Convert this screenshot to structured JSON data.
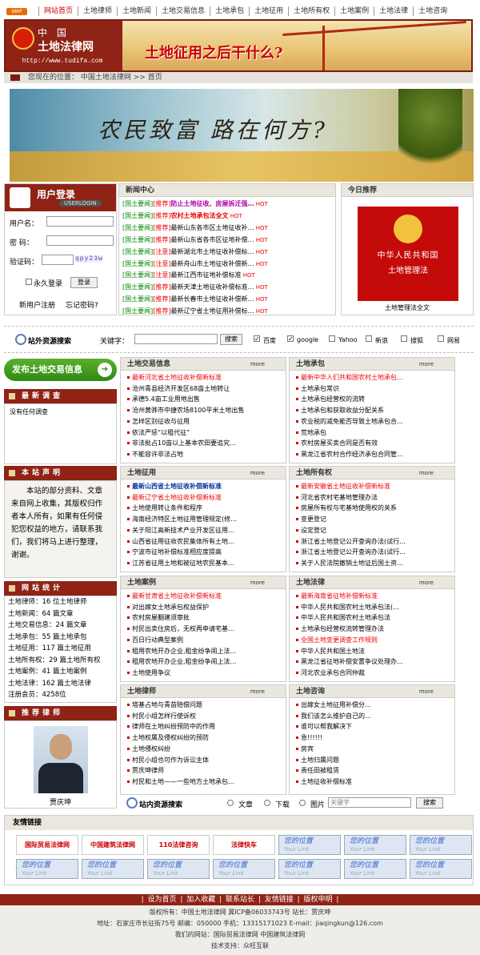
{
  "nav": {
    "wap": "WAP",
    "items": [
      "网站首页",
      "土地律师",
      "土地新闻",
      "土地交易信息",
      "土地承包",
      "土地征用",
      "土地所有权",
      "土地案例",
      "土地法律",
      "土地咨询"
    ]
  },
  "header": {
    "site_cn_1": "中  国",
    "site_cn_2": "土地法律网",
    "url": "http://www.tudifa.com",
    "slogan": "土地征用之后干什么?"
  },
  "location": {
    "label": "您现在的位置：",
    "path": "中国土地法律网 >> 首页"
  },
  "farm_banner": {
    "text": "农民致富  路在何方?"
  },
  "login": {
    "title": "用户登录",
    "subtitle": "USERLOGIN",
    "user_label": "用户名：",
    "pass_label": "密  码：",
    "code_label": "验证码：",
    "captcha": "qpy23w",
    "remember": "永久登录",
    "login_btn": "登录",
    "register": "新用户注册",
    "forgot": "忘记密码?"
  },
  "news_center": {
    "title": "新闻中心",
    "items": [
      {
        "tag": "[国土要闻]",
        "flag": "[推荐]",
        "text": "防止土地征收、房屋拆迁强…",
        "style": "hl2",
        "hot": "HOT"
      },
      {
        "tag": "[国土要闻]",
        "flag": "[推荐]",
        "text": "农村土地承包法全文",
        "style": "hl",
        "hot": "HOT"
      },
      {
        "tag": "[国土要闻]",
        "flag": "[推荐]",
        "text": "最新山东各市区土地征收补…",
        "style": "",
        "hot": "HOT"
      },
      {
        "tag": "[国土要闻]",
        "flag": "[推荐]",
        "text": "最新山东省各市区征地补偿…",
        "style": "",
        "hot": "HOT"
      },
      {
        "tag": "[国土要闻]",
        "flag": "[注意]",
        "text": "最新湖北市土地征收补偿标…",
        "style": "",
        "hot": "HOT"
      },
      {
        "tag": "[国土要闻]",
        "flag": "[注意]",
        "text": "最新舟山市土地征收补偿新…",
        "style": "",
        "hot": "HOT"
      },
      {
        "tag": "[国土要闻]",
        "flag": "[注意]",
        "text": "最新江西市征地补偿标准",
        "style": "",
        "hot": "HOT"
      },
      {
        "tag": "[国土要闻]",
        "flag": "[推荐]",
        "text": "最新天津土地征收补偿标准…",
        "style": "",
        "hot": "HOT"
      },
      {
        "tag": "[国土要闻]",
        "flag": "[推荐]",
        "text": "最新长春市土地征收补偿新…",
        "style": "",
        "hot": "HOT"
      },
      {
        "tag": "[国土要闻]",
        "flag": "[推荐]",
        "text": "最新辽宁省土地征用补偿标…",
        "style": "",
        "hot": "HOT"
      }
    ]
  },
  "recommend": {
    "title": "今日推荐",
    "book_line1": "中华人民共和国",
    "book_line2": "土地管理法",
    "caption": "土地管理法全文"
  },
  "search_out": {
    "label": "站外资源搜索",
    "kw_label": "关键字：",
    "btn": "搜索",
    "engines": [
      "百度",
      "google",
      "Yahoo",
      "新浪",
      "搜狐",
      "网易"
    ]
  },
  "publish_btn": "发布土地交易信息",
  "survey": {
    "title": "最新调查",
    "text": "没有任何调查"
  },
  "statement": {
    "title": "本站声明",
    "text": "本站的部分资料、文章来自网上收集，其版权归作者本人所有，如果有任何侵犯您权益的地方，请联系我们，我们将马上进行整理，谢谢。"
  },
  "stats": {
    "title": "网站统计",
    "lines": [
      "土地律师：16 位土地律师",
      "土地新闻：64 篇文章",
      "土地交易信息：24 篇文章",
      "土地承包：55 篇土地承包",
      "土地征用：117 篇土地征用",
      "土地所有权：29 篇土地所有权",
      "土地案例：41 篇土地案例",
      "土地法律：162 篇土地法律",
      "注册会员：4258位"
    ]
  },
  "lawyer": {
    "title": "推荐律师",
    "name": "贾庆坤"
  },
  "more": "more",
  "sections": [
    {
      "title": "土地交易信息",
      "items": [
        {
          "t": "最新河北省土地征收补偿新标准",
          "c": "red"
        },
        {
          "t": "沧州青县经济开发区68亩土地转让",
          "c": ""
        },
        {
          "t": "承德5.4亩工业用地出售",
          "c": ""
        },
        {
          "t": "沧州黄骅市中捷农场8100平米土地出售",
          "c": ""
        },
        {
          "t": "怎样区别征收与征用",
          "c": ""
        },
        {
          "t": "依法严惩“以租代征”",
          "c": ""
        },
        {
          "t": "非法批占10亩以上基本农田要追究…",
          "c": ""
        },
        {
          "t": "不能容许非法占地",
          "c": ""
        }
      ]
    },
    {
      "title": "土地承包",
      "items": [
        {
          "t": "最新中华人们共和国农村土地承包…",
          "c": "red"
        },
        {
          "t": "土地承包常识",
          "c": ""
        },
        {
          "t": "土地承包经营权的流转",
          "c": ""
        },
        {
          "t": "土地承包和获取收益分配关系",
          "c": ""
        },
        {
          "t": "农业税的减免能否导致土地承包合…",
          "c": ""
        },
        {
          "t": "荒地承包",
          "c": ""
        },
        {
          "t": "农村房屋买卖合同是否有效",
          "c": ""
        },
        {
          "t": "黑龙江省农村合作经济承包合同管…",
          "c": ""
        }
      ]
    },
    {
      "title": "土地征用",
      "items": [
        {
          "t": "最新山西省土地征收补偿新标准",
          "c": "blue"
        },
        {
          "t": "最新辽宁省土地征收补偿新标准",
          "c": "red"
        },
        {
          "t": "土地使用转让条件和程序",
          "c": ""
        },
        {
          "t": "海南经济特区土地征用管理规定(修…",
          "c": ""
        },
        {
          "t": "关于阳江高新技术产业开发区征用…",
          "c": ""
        },
        {
          "t": "山西省征用征收农民集体所有土地…",
          "c": ""
        },
        {
          "t": "宁波市征地补偿标准相应度提高",
          "c": ""
        },
        {
          "t": "江苏省征用土地和被征地农民基本…",
          "c": ""
        }
      ]
    },
    {
      "title": "土地所有权",
      "items": [
        {
          "t": "最新安徽省土地征收补偿新标准",
          "c": "red"
        },
        {
          "t": "河北省农村宅基地管理办法",
          "c": ""
        },
        {
          "t": "房屋所有权与宅基地使用权的关系",
          "c": ""
        },
        {
          "t": "变更登记",
          "c": ""
        },
        {
          "t": "设定登记",
          "c": ""
        },
        {
          "t": "浙江省土地登记公开查询办法(试行…",
          "c": ""
        },
        {
          "t": "浙江省土地登记公开查询办法(试行…",
          "c": ""
        },
        {
          "t": "关于人民法院撤销土地证后国土资…",
          "c": ""
        }
      ]
    },
    {
      "title": "土地案例",
      "items": [
        {
          "t": "最新甘肃省土地征收补偿新标准",
          "c": "red"
        },
        {
          "t": "对出嫁女土地承包权益保护",
          "c": ""
        },
        {
          "t": "农村房屋翻建须审批",
          "c": ""
        },
        {
          "t": "村民出卖住房后，无权再申请宅基…",
          "c": ""
        },
        {
          "t": "百日行动典型案例",
          "c": ""
        },
        {
          "t": "租用农地开办企业,租金纷争闹上法…",
          "c": ""
        },
        {
          "t": "租用农地开办企业,租金纷争闹上法…",
          "c": ""
        },
        {
          "t": "土地使用争议",
          "c": ""
        }
      ]
    },
    {
      "title": "土地法律",
      "items": [
        {
          "t": "最新海南省征地补偿新标准",
          "c": "red"
        },
        {
          "t": "中华人民共和国农村土地承包法(…",
          "c": ""
        },
        {
          "t": "中华人民共和国农村土地承包法",
          "c": ""
        },
        {
          "t": "土地承包经营权流转管理办法",
          "c": ""
        },
        {
          "t": "全国土地变更调查工作规则",
          "c": "red"
        },
        {
          "t": "中华人民共和国土地法",
          "c": ""
        },
        {
          "t": "黑龙江省征地补偿安置争议处理办…",
          "c": ""
        },
        {
          "t": "河北农业承包合同仲裁",
          "c": ""
        }
      ]
    },
    {
      "title": "土地律师",
      "items": [
        {
          "t": "塔基占地与青苗赔偿问题",
          "c": ""
        },
        {
          "t": "村民小组怎样行使诉权",
          "c": ""
        },
        {
          "t": "律师在土地纠纷预防中的作用",
          "c": ""
        },
        {
          "t": "土地权属及侵权纠纷的预防",
          "c": ""
        },
        {
          "t": "土地侵权纠纷",
          "c": ""
        },
        {
          "t": "村民小组也可作为诉讼主体",
          "c": ""
        },
        {
          "t": "贾庆坤律师",
          "c": ""
        },
        {
          "t": "村民和土地——一些地方土地承包…",
          "c": ""
        }
      ]
    },
    {
      "title": "土地咨询",
      "items": [
        {
          "t": "出嫁女土地征用补偿分…",
          "c": ""
        },
        {
          "t": "我们该怎么维护自己的…",
          "c": ""
        },
        {
          "t": "谁可以帮我解决下",
          "c": ""
        },
        {
          "t": "急!!!!!!",
          "c": ""
        },
        {
          "t": "房宾",
          "c": ""
        },
        {
          "t": "土地归属问题",
          "c": ""
        },
        {
          "t": "责任田被租赁",
          "c": ""
        },
        {
          "t": "土地征收补偿标准",
          "c": ""
        }
      ]
    }
  ],
  "search_in": {
    "label": "站内资源搜索",
    "opts": [
      "文章",
      "下载",
      "图片"
    ],
    "placeholder": "关键字",
    "btn": "搜索"
  },
  "links": {
    "title": "友情链接",
    "logos": [
      "国际贸易法律网",
      "中国建筑法律网",
      "110法律咨询",
      "法律快车Lawtime.cn"
    ],
    "your_pos": "您的位置",
    "your_link": "Your Link"
  },
  "footer": {
    "menu": "| 设为首页 | 加入收藏 | 联系站长 | 友情链接 | 版权申明 |",
    "lines": [
      "版权所有：中国土地法律网  冀ICP备06033743号  站长：贾庆坤",
      "地址：石家庄市长征街75号  邮编：050000  手机：13315171023  E-mail：jiaqingkun@126.com",
      "我们的网站：国际贸易法律网  中国建筑法律网",
      "技术支持：众旺互联"
    ]
  },
  "colors": {
    "brand": "#8f2416",
    "accent_red": "#e00000",
    "panel_head": "#eae7de"
  }
}
